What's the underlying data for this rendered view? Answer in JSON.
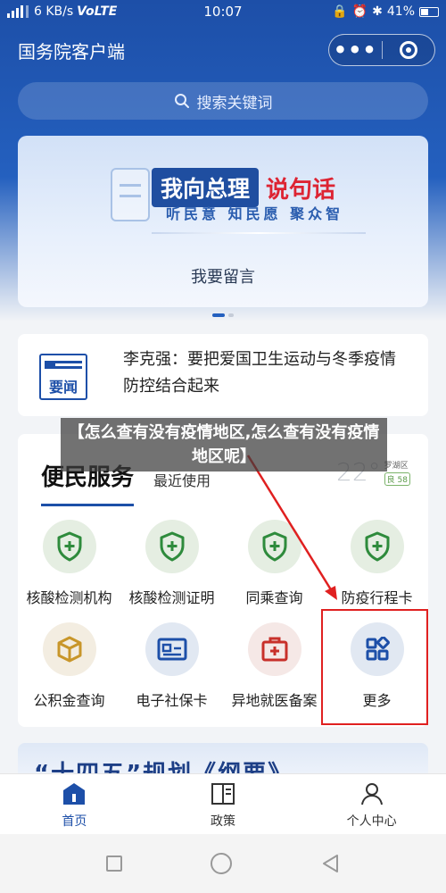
{
  "status_bar": {
    "signal_text": "ᵂ📶",
    "speed": "6 KB/s",
    "network": "VoLTE",
    "time": "10:07",
    "battery": "41%"
  },
  "header": {
    "title": "国务院客户端",
    "more_glyph": "•••"
  },
  "search": {
    "placeholder": "搜索关键词"
  },
  "banner": {
    "slogan_box": "我向总理",
    "slogan_red": "说句话",
    "slogan_sub": "听民意 知民愿 聚众智",
    "message": "我要留言"
  },
  "news": {
    "icon_label": "要闻",
    "headline": "李克强：要把爱国卫生运动与冬季疫情防控结合起来"
  },
  "services": {
    "title": "便民服务",
    "recent_tab": "最近使用",
    "weather": {
      "temp": "22°",
      "location": "罗湖区",
      "aqi": "良 58"
    },
    "items": [
      {
        "label": "核酸检测机构",
        "icon": "shield-plus-icon",
        "color": "#2e8b3c"
      },
      {
        "label": "核酸检测证明",
        "icon": "shield-plus-icon",
        "color": "#2e8b3c"
      },
      {
        "label": "同乘查询",
        "icon": "shield-plus-icon",
        "color": "#2e8b3c"
      },
      {
        "label": "防疫行程卡",
        "icon": "shield-plus-icon",
        "color": "#2e8b3c"
      },
      {
        "label": "公积金查询",
        "icon": "box-icon",
        "color": "#c8962a"
      },
      {
        "label": "电子社保卡",
        "icon": "id-card-icon",
        "color": "#1d4fa8"
      },
      {
        "label": "异地就医备案",
        "icon": "medical-kit-icon",
        "color": "#c8302a"
      },
      {
        "label": "更多",
        "icon": "grid-more-icon",
        "color": "#1d4fa8"
      }
    ]
  },
  "banner2": {
    "text": "“十四五”规划《纲要》"
  },
  "overlay_caption": "【怎么查有没有疫情地区,怎么查有没有疫情地区呢】",
  "tabbar": {
    "tabs": [
      {
        "label": "首页",
        "icon": "home-icon",
        "active": true
      },
      {
        "label": "政策",
        "icon": "policy-icon",
        "active": false
      },
      {
        "label": "个人中心",
        "icon": "person-icon",
        "active": false
      }
    ]
  },
  "colors": {
    "primary": "#1d4fa8",
    "highlight_red": "#e02020",
    "slogan_red": "#dd2433"
  }
}
